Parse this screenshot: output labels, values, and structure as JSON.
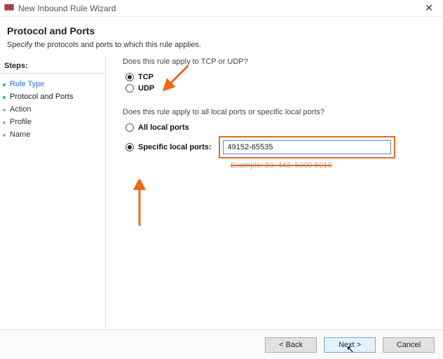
{
  "window": {
    "title": "New Inbound Rule Wizard"
  },
  "header": {
    "heading": "Protocol and Ports",
    "subtext": "Specify the protocols and ports to which this rule applies."
  },
  "sidebar": {
    "label": "Steps:",
    "items": [
      {
        "label": "Rule Type",
        "state": "completed"
      },
      {
        "label": "Protocol and Ports",
        "state": "current"
      },
      {
        "label": "Action",
        "state": "pending"
      },
      {
        "label": "Profile",
        "state": "pending"
      },
      {
        "label": "Name",
        "state": "pending"
      }
    ]
  },
  "content": {
    "q1": "Does this rule apply to TCP or UDP?",
    "proto": {
      "tcp_label": "TCP",
      "udp_label": "UDP",
      "selected": "tcp"
    },
    "q2": "Does this rule apply to all local ports or specific local ports?",
    "ports": {
      "all_label": "All local ports",
      "specific_label": "Specific local ports:",
      "selected": "specific",
      "value": "49152-65535",
      "example": "Example: 80, 443, 5000-5010"
    }
  },
  "footer": {
    "back": "< Back",
    "next": "Next >",
    "cancel": "Cancel"
  }
}
